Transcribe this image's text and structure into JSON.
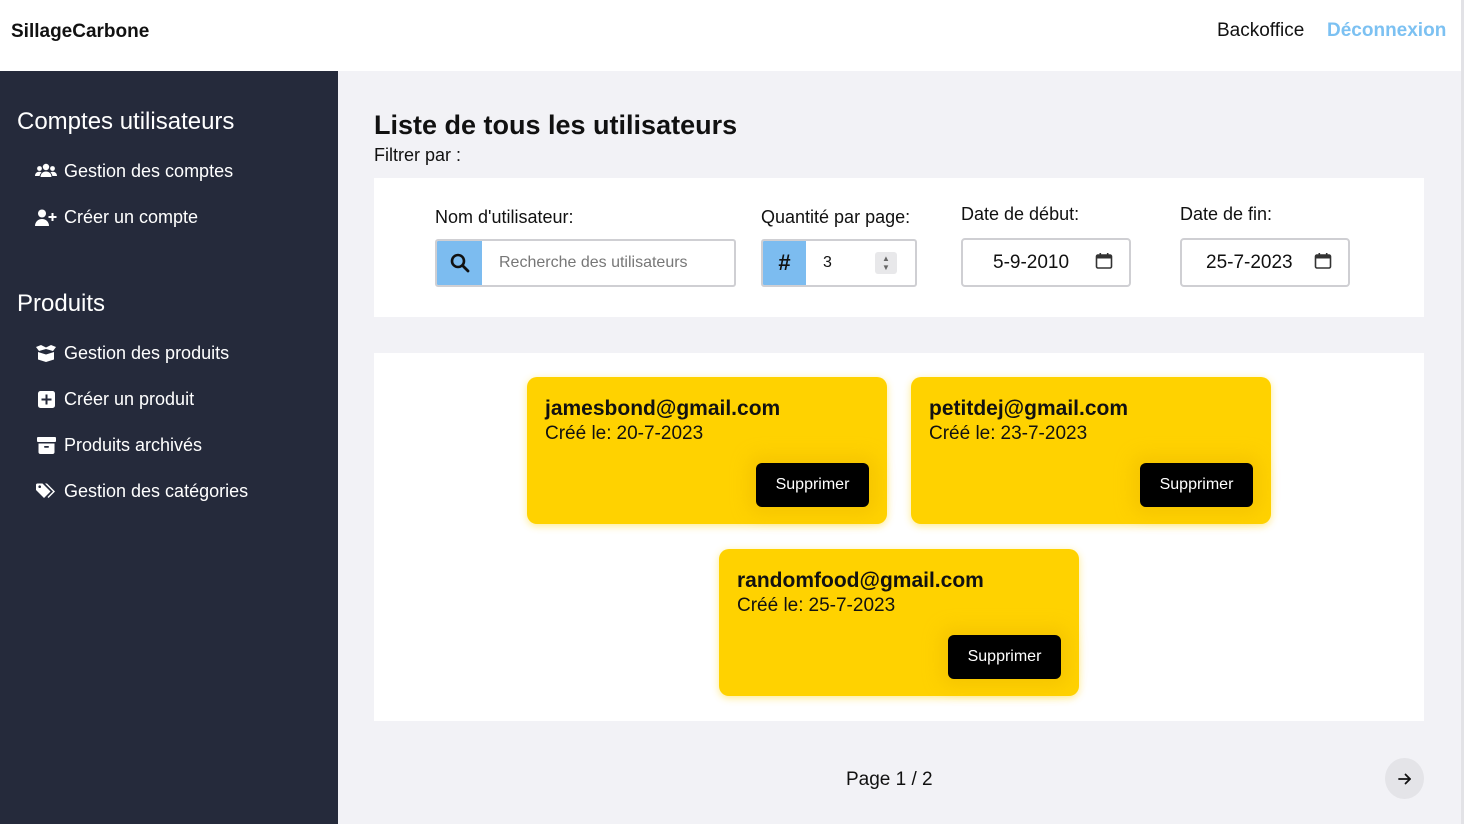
{
  "header": {
    "brand": "SillageCarbone",
    "links": {
      "backoffice": "Backoffice",
      "logout": "Déconnexion"
    },
    "logout_color": "#7cc1f2"
  },
  "sidebar": {
    "sections": [
      {
        "title": "Comptes utilisateurs",
        "items": [
          {
            "label": "Gestion des comptes",
            "icon": "users-icon"
          },
          {
            "label": "Créer un compte",
            "icon": "user-plus-icon"
          }
        ]
      },
      {
        "title": "Produits",
        "items": [
          {
            "label": "Gestion des produits",
            "icon": "box-open-icon"
          },
          {
            "label": "Créer un produit",
            "icon": "square-plus-icon"
          },
          {
            "label": "Produits archivés",
            "icon": "archive-icon"
          },
          {
            "label": "Gestion des catégories",
            "icon": "tags-icon"
          }
        ]
      }
    ],
    "background": "#252a3b"
  },
  "main": {
    "title": "Liste de tous les utilisateurs",
    "filter_prompt": "Filtrer par :",
    "filters": {
      "username": {
        "label": "Nom d'utilisateur:",
        "placeholder": "Recherche des utilisateurs",
        "value": ""
      },
      "quantity": {
        "label": "Quantité par page:",
        "value": "3"
      },
      "start_date": {
        "label": "Date de début:",
        "value": "5-9-2010"
      },
      "end_date": {
        "label": "Date de fin:",
        "value": "25-7-2023"
      }
    },
    "users": [
      {
        "email": "jamesbond@gmail.com",
        "created_label": "Créé le:",
        "created": "20-7-2023",
        "delete_label": "Supprimer"
      },
      {
        "email": "petitdej@gmail.com",
        "created_label": "Créé le:",
        "created": "23-7-2023",
        "delete_label": "Supprimer"
      },
      {
        "email": "randomfood@gmail.com",
        "created_label": "Créé le:",
        "created": "25-7-2023",
        "delete_label": "Supprimer"
      }
    ],
    "pagination": {
      "text": "Page 1 / 2",
      "current": 1,
      "total": 2,
      "next_icon": "arrow-right-icon"
    },
    "card_color": "#ffd200",
    "accent_color": "#7cbcf0"
  }
}
